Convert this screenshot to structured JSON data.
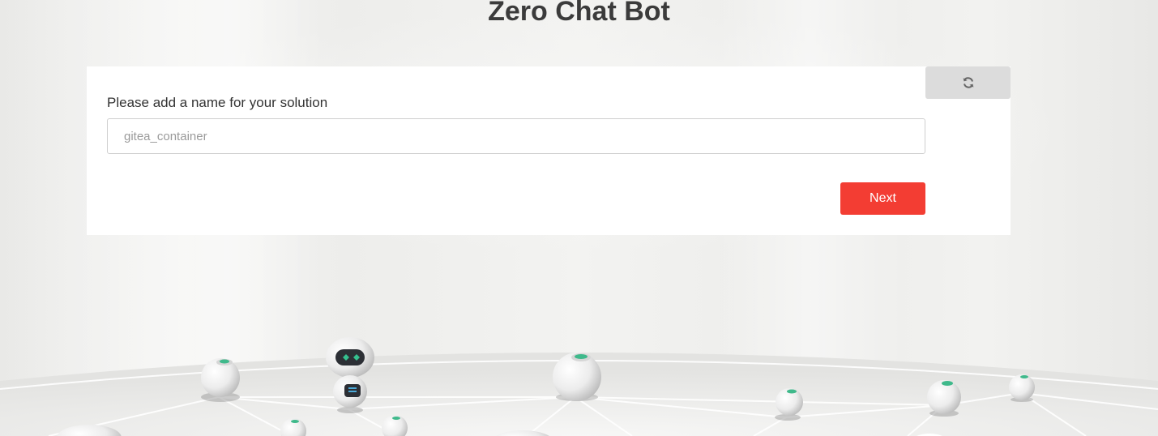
{
  "page": {
    "title": "Zero Chat Bot"
  },
  "form": {
    "field_label": "Please add a name for your solution",
    "input_value": "",
    "input_placeholder": "gitea_container",
    "next_label": "Next",
    "refresh_icon": "refresh-icon"
  },
  "colors": {
    "accent": "#f33d33",
    "refresh_bg": "#dcdcdc",
    "title": "#3b3b3b"
  }
}
